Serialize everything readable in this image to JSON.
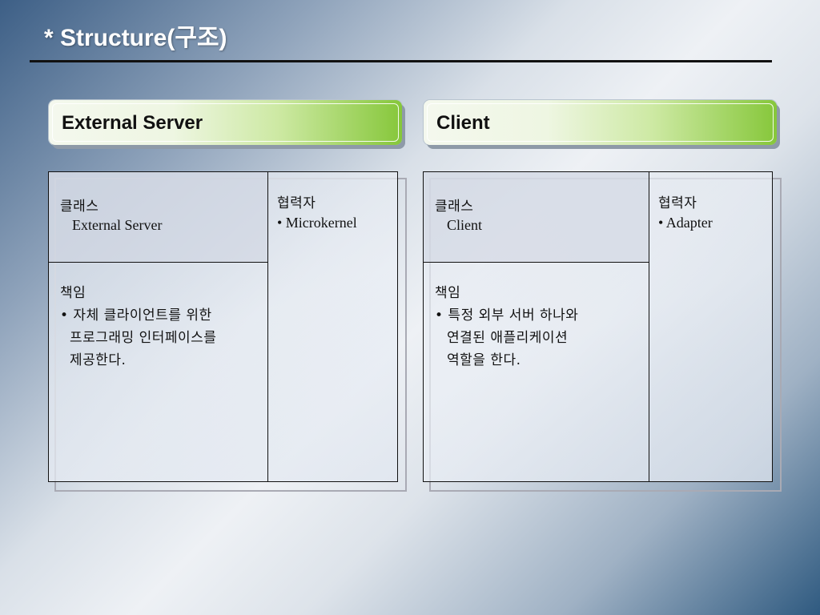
{
  "title": "* Structure(구조)",
  "cards": [
    {
      "header": "External Server",
      "class_label": "클래스",
      "class_name": "External Server",
      "collab_label": "협력자",
      "collaborator": "• Microkernel",
      "resp_label": "책임",
      "resp_lines": [
        "• 자체 클라이언트를 위한",
        "프로그래밍 인터페이스를",
        "제공한다."
      ]
    },
    {
      "header": "Client",
      "class_label": "클래스",
      "class_name": "Client",
      "collab_label": "협력자",
      "collaborator": "• Adapter",
      "resp_label": "책임",
      "resp_lines": [
        "• 특정 외부 서버 하나와",
        "연결된 애플리케이션",
        "역할을 한다."
      ]
    }
  ]
}
